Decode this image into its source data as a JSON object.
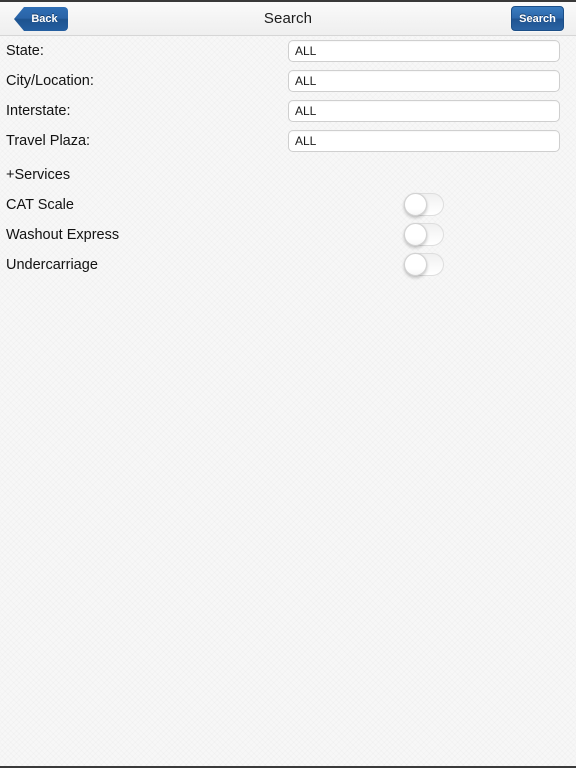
{
  "navbar": {
    "back_label": "Back",
    "title": "Search",
    "search_label": "Search"
  },
  "form": {
    "fields": [
      {
        "label": "State:",
        "value": "ALL",
        "placeholder": "ALL"
      },
      {
        "label": "City/Location:",
        "value": "ALL",
        "placeholder": "ALL"
      },
      {
        "label": "Interstate:",
        "value": "ALL",
        "placeholder": "ALL"
      },
      {
        "label": "Travel Plaza:",
        "value": "ALL",
        "placeholder": "ALL"
      }
    ]
  },
  "services": {
    "heading": "+Services",
    "toggles": [
      {
        "label": "CAT Scale",
        "state": "off"
      },
      {
        "label": "Washout Express",
        "state": "off"
      },
      {
        "label": "Undercarriage",
        "state": "off"
      }
    ]
  },
  "colors": {
    "accent_blue": "#2a64a7",
    "page_background": "#f7f7f7",
    "text": "#121212",
    "input_border": "#cfcfcf"
  }
}
